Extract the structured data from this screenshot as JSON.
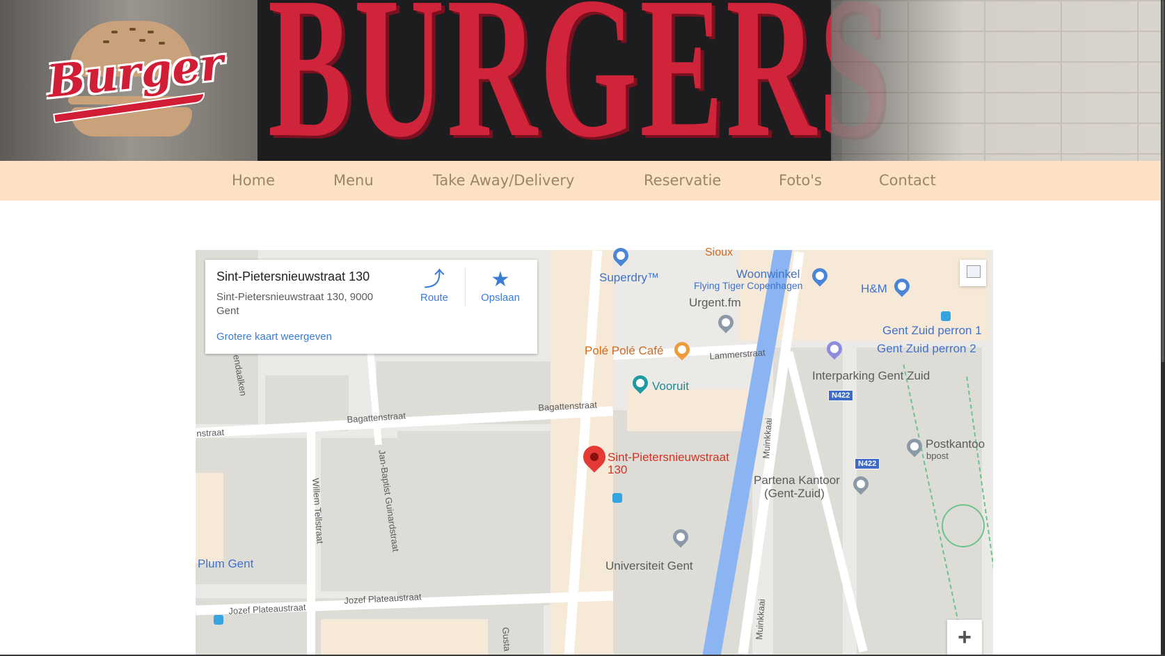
{
  "brand": {
    "logo_text": "Burger",
    "sign_text": "BURGERS"
  },
  "nav": {
    "items": [
      {
        "label": "Home"
      },
      {
        "label": "Menu"
      },
      {
        "label": "Take Away/Delivery"
      },
      {
        "label": "Reservatie"
      },
      {
        "label": "Foto's"
      },
      {
        "label": "Contact"
      }
    ]
  },
  "map": {
    "info_card": {
      "title": "Sint-Pietersnieuwstraat 130",
      "address": "Sint-Pietersnieuwstraat 130, 9000 Gent",
      "route_label": "Route",
      "save_label": "Opslaan",
      "larger_map_link": "Grotere kaart weergeven"
    },
    "marker_label_line1": "Sint-Pietersnieuwstraat",
    "marker_label_line2": "130",
    "pois": {
      "superdry": "Superdry™",
      "sioux": "Sioux",
      "woonwinkel": "Woonwinkel",
      "flying_tiger": "Flying Tiger Copenhagen",
      "hm": "H&M",
      "urgent": "Urgent.fm",
      "pole_pole": "Polé Polé Café",
      "gent_zuid_1": "Gent Zuid perron 1",
      "gent_zuid_2": "Gent Zuid perron 2",
      "interparking": "Interparking Gent Zuid",
      "vooruit": "Vooruit",
      "postkantoor": "Postkantoo",
      "bpost": "bpost",
      "partena_1": "Partena Kantoor",
      "partena_2": "(Gent-Zuid)",
      "universiteit": "Universiteit Gent",
      "plum": "Plum Gent"
    },
    "streets": {
      "lammerstraat": "Lammerstraat",
      "bagattenstraat_1": "Bagattenstraat",
      "bagattenstraat_2": "Bagattenstraat",
      "muinkkaai_1": "Muinkkaai",
      "muinkkaai_2": "Muinkkaai",
      "jan_baptist": "Jan-Baptist Guinardstraat",
      "willem_tell": "Willem Tellstraat",
      "jozef_1": "Jozef Plateaustraat",
      "jozef_2": "Jozef Plateaustraat",
      "endaalken": "endaalken",
      "nstraat": "nstraat",
      "gusta": "Gusta"
    },
    "road_signs": [
      "N422",
      "N422"
    ],
    "zoom_in": "+"
  }
}
